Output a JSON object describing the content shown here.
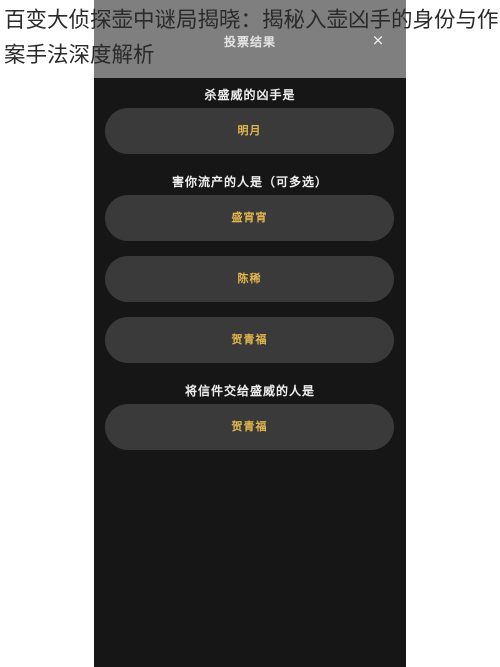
{
  "headline": "百变大侦探壶中谜局揭晓：揭秘入壶凶手的身份与作案手法深度解析",
  "panel": {
    "title": "投票结果",
    "close_icon": "close-icon",
    "close_glyph": "×"
  },
  "questions": [
    {
      "prompt": "杀盛威的凶手是",
      "options": [
        "明月"
      ]
    },
    {
      "prompt": "害你流产的人是（可多选）",
      "options": [
        "盛宵宵",
        "陈稀",
        "贺青福"
      ]
    },
    {
      "prompt": "将信件交给盛威的人是",
      "options": [
        "贺青福"
      ]
    }
  ],
  "colors": {
    "background": "#161616",
    "header": "#7f7f7f",
    "option_bg": "#3a3a3a",
    "option_text": "#e2b64c",
    "question_text": "#eeeeee"
  }
}
